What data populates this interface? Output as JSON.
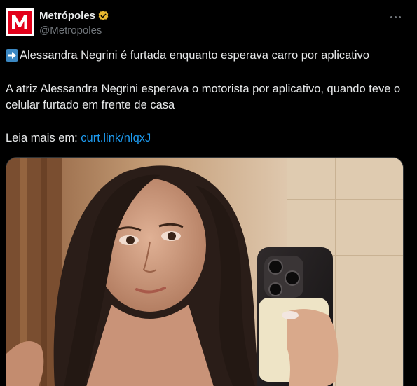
{
  "tweet": {
    "author": {
      "display_name": "Metrópoles",
      "handle": "@Metropoles",
      "avatar_icon": "metropoles-logo-icon",
      "verified_icon": "verified-badge-icon",
      "logo_letter": "M"
    },
    "more_icon": "more-options-icon",
    "headline": "Alessandra Negrini é furtada enquanto esperava carro por aplicativo",
    "headline_icon": "right-arrow-emoji-icon",
    "body": "A atriz Alessandra Negrini esperava o motorista por aplicativo, quando teve o celular furtado em frente de casa",
    "read_more_label": "Leia mais em: ",
    "read_more_link": "curt.link/nlqxJ",
    "media_icon": "selfie-photo-image"
  },
  "colors": {
    "background": "#000000",
    "text": "#e7e9ea",
    "secondary_text": "#71767b",
    "link": "#1d9bf0",
    "brand_red": "#e2001a",
    "verified_gold": "#e8b830"
  }
}
